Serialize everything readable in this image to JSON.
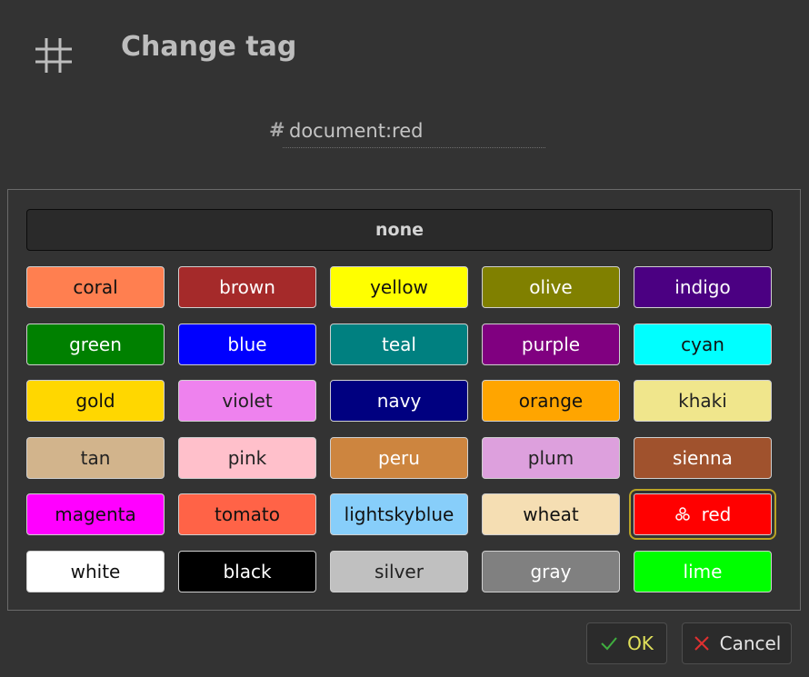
{
  "dialog": {
    "title": "Change tag",
    "tag_prefix": "#",
    "tag_value": "document:red"
  },
  "palette": {
    "none_label": "none",
    "selected": "red",
    "colors": [
      {
        "label": "coral",
        "bg": "#ff7f50",
        "fg": "#111111"
      },
      {
        "label": "brown",
        "bg": "#a52a2a",
        "fg": "#ffffff"
      },
      {
        "label": "yellow",
        "bg": "#ffff00",
        "fg": "#111111"
      },
      {
        "label": "olive",
        "bg": "#808000",
        "fg": "#ffffff"
      },
      {
        "label": "indigo",
        "bg": "#4b0082",
        "fg": "#ffffff"
      },
      {
        "label": "green",
        "bg": "#008000",
        "fg": "#ffffff"
      },
      {
        "label": "blue",
        "bg": "#0000ff",
        "fg": "#ffffff"
      },
      {
        "label": "teal",
        "bg": "#008080",
        "fg": "#ffffff"
      },
      {
        "label": "purple",
        "bg": "#800080",
        "fg": "#ffffff"
      },
      {
        "label": "cyan",
        "bg": "#00ffff",
        "fg": "#111111"
      },
      {
        "label": "gold",
        "bg": "#ffd700",
        "fg": "#111111"
      },
      {
        "label": "violet",
        "bg": "#ee82ee",
        "fg": "#222222"
      },
      {
        "label": "navy",
        "bg": "#000080",
        "fg": "#ffffff"
      },
      {
        "label": "orange",
        "bg": "#ffa500",
        "fg": "#111111"
      },
      {
        "label": "khaki",
        "bg": "#f0e68c",
        "fg": "#222222"
      },
      {
        "label": "tan",
        "bg": "#d2b48c",
        "fg": "#222222"
      },
      {
        "label": "pink",
        "bg": "#ffc0cb",
        "fg": "#222222"
      },
      {
        "label": "peru",
        "bg": "#cd853f",
        "fg": "#ffffff"
      },
      {
        "label": "plum",
        "bg": "#dda0dd",
        "fg": "#222222"
      },
      {
        "label": "sienna",
        "bg": "#a0522d",
        "fg": "#ffffff"
      },
      {
        "label": "magenta",
        "bg": "#ff00ff",
        "fg": "#111111"
      },
      {
        "label": "tomato",
        "bg": "#ff6347",
        "fg": "#111111"
      },
      {
        "label": "lightskyblue",
        "bg": "#87cefa",
        "fg": "#111111"
      },
      {
        "label": "wheat",
        "bg": "#f5deb3",
        "fg": "#111111"
      },
      {
        "label": "red",
        "bg": "#ff0000",
        "fg": "#ffffff"
      },
      {
        "label": "white",
        "bg": "#ffffff",
        "fg": "#111111"
      },
      {
        "label": "black",
        "bg": "#000000",
        "fg": "#ffffff"
      },
      {
        "label": "silver",
        "bg": "#c0c0c0",
        "fg": "#222222"
      },
      {
        "label": "gray",
        "bg": "#808080",
        "fg": "#ffffff"
      },
      {
        "label": "lime",
        "bg": "#00ff00",
        "fg": "#ffffff"
      }
    ]
  },
  "buttons": {
    "ok_label": "OK",
    "cancel_label": "Cancel"
  },
  "icons": {
    "title_icon": "hash-icon",
    "selected_icon": "cluster-icon",
    "ok_icon": "check-icon",
    "cancel_icon": "x-icon"
  }
}
